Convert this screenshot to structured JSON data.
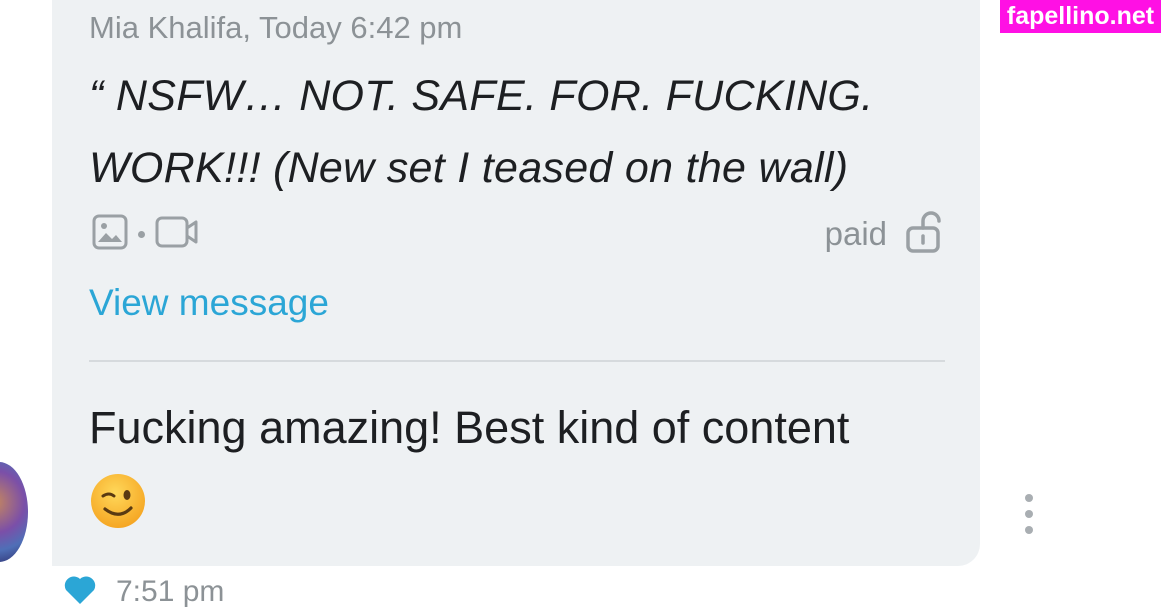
{
  "message": {
    "quote": {
      "author_time": "Mia Khalifa, Today 6:42 pm",
      "text": "“ NSFW… NOT. SAFE. FOR. FUCKING. WORK!!! (New set I teased on the wall)",
      "media_icons": [
        "image-icon",
        "video-icon"
      ],
      "price_label": "paid",
      "lock_icon": "unlock-icon"
    },
    "view_link": "View message",
    "reply_text": "Fucking amazing! Best kind of content",
    "emoji": "winking-face-emoji",
    "footer_time": "7:51 pm"
  },
  "watermark": "fapellino.net",
  "colors": {
    "bubble": "#eef1f3",
    "link": "#2ba6d6",
    "muted": "#8c9296",
    "heart": "#2ba6d6",
    "watermark_bg": "#ff10e4"
  }
}
